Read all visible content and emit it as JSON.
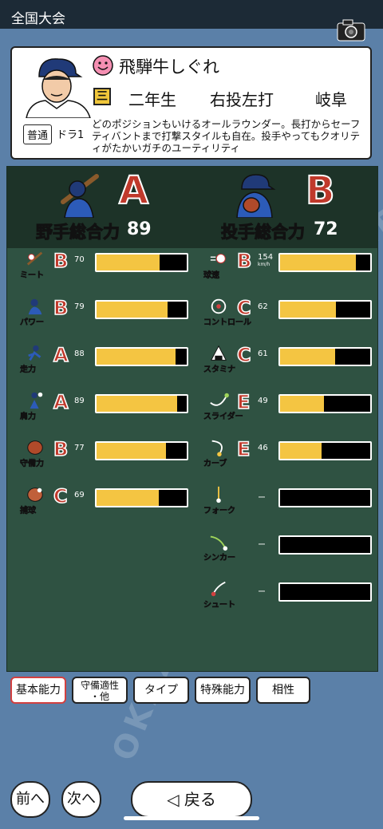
{
  "header": {
    "title": "全国大会"
  },
  "player": {
    "name": "飛騨牛しぐれ",
    "grade_mark": "三",
    "grade": "二年生",
    "throw_bat": "右投左打",
    "prefecture": "岐阜",
    "type_badge": "普通",
    "draft": "ドラ1",
    "description": "どのポジションもいけるオールラウンダー。長打からセーフティバントまで打撃スタイルも自在。投手やってもクオリティがたかいガチのユーティリティ"
  },
  "fielder": {
    "label": "野手総合力",
    "rank": "A",
    "value": "89"
  },
  "pitcher": {
    "label": "投手総合力",
    "rank": "B",
    "value": "72"
  },
  "fielder_stats": [
    {
      "name": "ミート",
      "grade": "B",
      "value": "70",
      "level": 0.7,
      "icon": "bat-hit-icon"
    },
    {
      "name": "パワー",
      "grade": "B",
      "value": "79",
      "level": 0.79,
      "icon": "power-icon"
    },
    {
      "name": "走力",
      "grade": "A",
      "value": "88",
      "level": 0.88,
      "icon": "runner-icon"
    },
    {
      "name": "肩力",
      "grade": "A",
      "value": "89",
      "level": 0.89,
      "icon": "arm-icon"
    },
    {
      "name": "守備力",
      "grade": "B",
      "value": "77",
      "level": 0.77,
      "icon": "glove-icon"
    },
    {
      "name": "捕球",
      "grade": "C",
      "value": "69",
      "level": 0.69,
      "icon": "mitt-icon"
    }
  ],
  "pitcher_stats": [
    {
      "name": "球速",
      "grade": "B",
      "value": "154",
      "unit": "km/h",
      "level": 0.84,
      "icon": "fastball-icon"
    },
    {
      "name": "コントロール",
      "grade": "C",
      "value": "62",
      "level": 0.62,
      "icon": "control-icon"
    },
    {
      "name": "スタミナ",
      "grade": "C",
      "value": "61",
      "level": 0.61,
      "icon": "stamina-icon"
    },
    {
      "name": "スライダー",
      "grade": "E",
      "value": "49",
      "level": 0.49,
      "icon": "slider-icon"
    },
    {
      "name": "カーブ",
      "grade": "E",
      "value": "46",
      "level": 0.46,
      "icon": "curve-icon"
    },
    {
      "name": "フォーク",
      "grade": "",
      "value": "ー",
      "level": 0,
      "icon": "fork-icon"
    },
    {
      "name": "シンカー",
      "grade": "",
      "value": "ー",
      "level": 0,
      "icon": "sinker-icon"
    },
    {
      "name": "シュート",
      "grade": "",
      "value": "ー",
      "level": 0,
      "icon": "shoot-icon"
    }
  ],
  "tabs": [
    "基本能力",
    "守備適性\n・他",
    "タイプ",
    "特殊能力",
    "相性"
  ],
  "nav": {
    "prev": "前へ",
    "next": "次へ",
    "back": "◁ 戻る"
  },
  "colors": {
    "field": "#2f5242",
    "bar_fill": "#f4c542",
    "rank_red": "#c0392b"
  }
}
